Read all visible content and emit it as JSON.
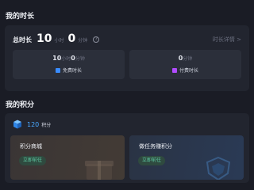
{
  "time_section": {
    "title": "我的时长",
    "total_label": "总时长",
    "hours": "10",
    "hours_unit": "小时",
    "minutes": "0",
    "minutes_unit": "分钟",
    "help_icon": "?",
    "detail_link": "时长详情 >",
    "free": {
      "hours": "10",
      "hours_unit": "小时",
      "minutes": "0",
      "minutes_unit": "分钟",
      "label": "免费时长",
      "icon": "free-tag-icon",
      "color": "#3a8cff"
    },
    "paid": {
      "minutes": "0",
      "minutes_unit": "分钟",
      "label": "付费时长",
      "icon": "paid-tag-icon",
      "color": "#b04cff"
    }
  },
  "points_section": {
    "title": "我的积分",
    "icon": "cube-icon",
    "value": "120",
    "unit": "积分",
    "accent": "#4aa8ff",
    "cards": [
      {
        "title": "积分商城",
        "button": "立即前往",
        "decoration": "gift-box-icon"
      },
      {
        "title": "做任务赚积分",
        "button": "立即前往",
        "decoration": "shield-icon"
      }
    ]
  }
}
